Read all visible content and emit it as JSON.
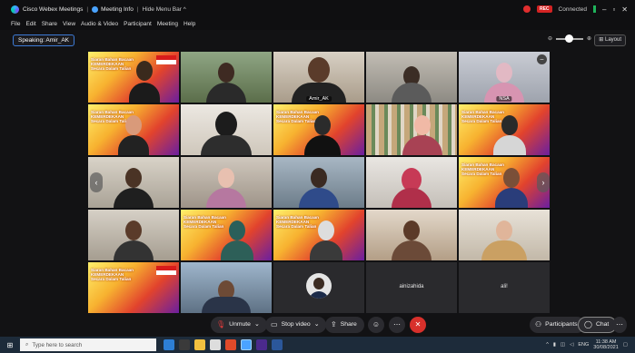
{
  "window": {
    "app_title": "Cisco Webex Meetings",
    "meeting_info_label": "Meeting Info",
    "hide_menu_bar_label": "Hide Menu Bar",
    "recording_badge": "REC",
    "status": "Connected",
    "minimize": "–",
    "maximize": "▫",
    "close": "✕"
  },
  "menu": [
    "File",
    "Edit",
    "Share",
    "View",
    "Audio & Video",
    "Participant",
    "Meeting",
    "Help"
  ],
  "speaking": {
    "label": "Speaking: Amir_AK"
  },
  "layout_button": "Layout",
  "tiles": [
    {
      "name": ""
    },
    {
      "name": ""
    },
    {
      "name": "Amir_AK"
    },
    {
      "name": ""
    },
    {
      "name": "NSA"
    },
    {
      "name": ""
    },
    {
      "name": ""
    },
    {
      "name": ""
    },
    {
      "name": ""
    },
    {
      "name": ""
    },
    {
      "name": ""
    },
    {
      "name": ""
    },
    {
      "name": ""
    },
    {
      "name": ""
    },
    {
      "name": ""
    },
    {
      "name": ""
    },
    {
      "name": ""
    },
    {
      "name": ""
    },
    {
      "name": ""
    },
    {
      "name": ""
    },
    {
      "name": ""
    },
    {
      "name": ""
    },
    {
      "name": ""
    },
    {
      "name": "ainizahida"
    },
    {
      "name": "ali!"
    }
  ],
  "poster": {
    "title": "Siaran Bahan Bacaan KEMERDEKAAN Secara Dalam Talian"
  },
  "controls": {
    "unmute": "Unmute",
    "stop_video": "Stop video",
    "share": "Share",
    "participants": "Participants",
    "chat": "Chat"
  },
  "taskbar": {
    "search_placeholder": "Type here to search",
    "language": "ENG",
    "time": "11:38 AM",
    "date": "30/08/2021"
  },
  "colors": {
    "accent": "#2f6de0",
    "end_call": "#d8302b",
    "taskbar": "#1d2b3a"
  }
}
